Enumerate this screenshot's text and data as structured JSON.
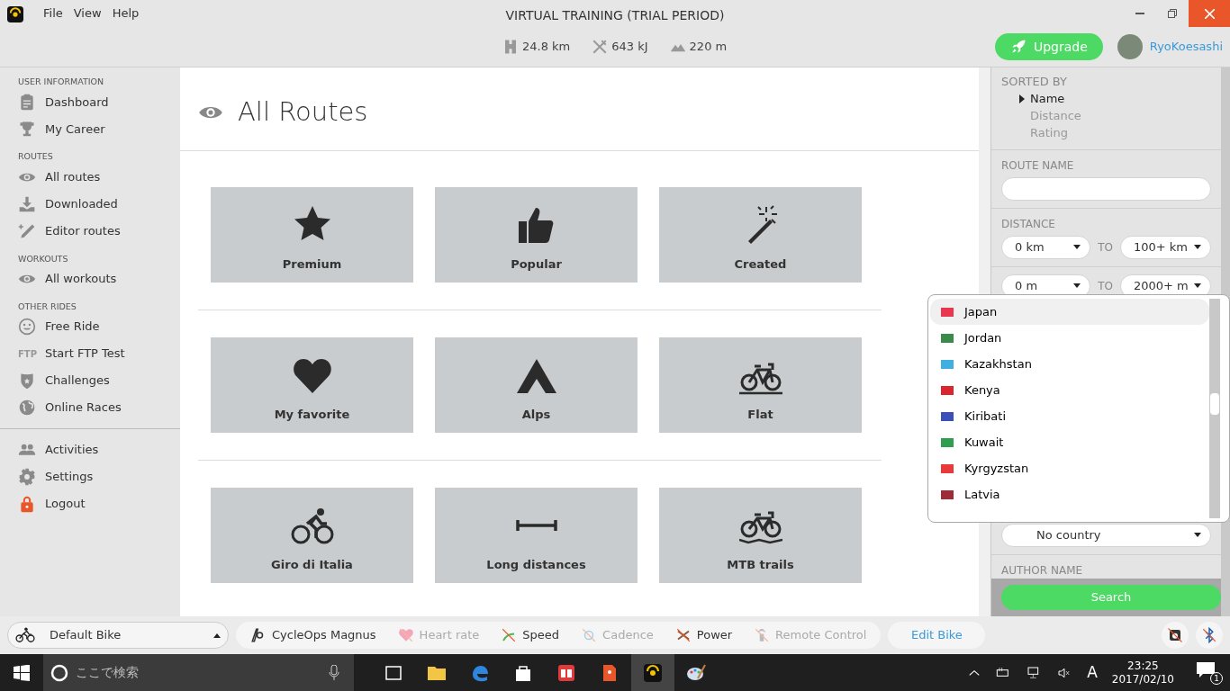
{
  "window": {
    "title": "VIRTUAL TRAINING (TRIAL PERIOD)",
    "menu": [
      "File",
      "View",
      "Help"
    ]
  },
  "stats": [
    {
      "kind": "road",
      "value": "24.8 km"
    },
    {
      "kind": "food",
      "value": "643 kJ"
    },
    {
      "kind": "mountain",
      "value": "220 m"
    }
  ],
  "upgrade_button": "Upgrade",
  "user": {
    "name": "RyoKoesashi"
  },
  "sidebar": [
    {
      "heading": "USER INFORMATION",
      "items": [
        {
          "kind": "clipboard",
          "label": "Dashboard"
        },
        {
          "kind": "trophy",
          "label": "My Career"
        }
      ]
    },
    {
      "heading": "ROUTES",
      "items": [
        {
          "kind": "eye",
          "label": "All routes"
        },
        {
          "kind": "download",
          "label": "Downloaded"
        },
        {
          "kind": "pencil",
          "label": "Editor routes"
        }
      ]
    },
    {
      "heading": "WORKOUTS",
      "items": [
        {
          "kind": "eye",
          "label": "All workouts"
        }
      ]
    },
    {
      "heading": "OTHER RIDES",
      "items": [
        {
          "kind": "smile",
          "label": "Free Ride"
        },
        {
          "kind": "ftp",
          "icon_text": "FTP",
          "label": "Start FTP Test"
        },
        {
          "kind": "shield",
          "label": "Challenges"
        },
        {
          "kind": "globe",
          "label": "Online Races"
        }
      ]
    },
    {
      "items": [
        {
          "kind": "people",
          "label": "Activities"
        },
        {
          "kind": "gear",
          "label": "Settings"
        },
        {
          "kind": "lock",
          "label": "Logout"
        }
      ]
    }
  ],
  "page": {
    "title": "All Routes"
  },
  "tile_rows": [
    [
      {
        "kind": "star",
        "label": "Premium"
      },
      {
        "kind": "thumb",
        "label": "Popular"
      },
      {
        "kind": "wand",
        "label": "Created"
      }
    ],
    [
      {
        "kind": "heart",
        "label": "My favorite"
      },
      {
        "kind": "mountain",
        "label": "Alps"
      },
      {
        "kind": "bike",
        "label": "Flat"
      }
    ],
    [
      {
        "kind": "cyclist",
        "label": "Giro di Italia"
      },
      {
        "kind": "distance",
        "label": "Long distances"
      },
      {
        "kind": "mtb",
        "label": "MTB trails"
      }
    ]
  ],
  "filters": {
    "sorted_by": {
      "heading": "SORTED BY",
      "options": [
        {
          "label": "Name",
          "selected": true
        },
        {
          "label": "Distance",
          "selected": false
        },
        {
          "label": "Rating",
          "selected": false
        }
      ]
    },
    "route_name": {
      "heading": "ROUTE NAME"
    },
    "distance": {
      "heading": "DISTANCE",
      "ranges": [
        {
          "from": "0 km",
          "to_label": "TO",
          "to": "100+ km"
        },
        {
          "from": "0 m",
          "to_label": "TO",
          "to": "2000+ m"
        }
      ]
    },
    "country": {
      "value": "No country"
    },
    "author_name": {
      "heading": "AUTHOR NAME"
    },
    "search_button": "Search"
  },
  "country_dropdown": [
    {
      "label": "Japan",
      "color": "#e8374f",
      "selected": true
    },
    {
      "label": "Jordan",
      "color": "#3a8a4a",
      "selected": false
    },
    {
      "label": "Kazakhstan",
      "color": "#3fb0e0",
      "selected": false
    },
    {
      "label": "Kenya",
      "color": "#d9262e",
      "selected": false
    },
    {
      "label": "Kiribati",
      "color": "#3a4fb8",
      "selected": false
    },
    {
      "label": "Kuwait",
      "color": "#2f9e4f",
      "selected": false
    },
    {
      "label": "Kyrgyzstan",
      "color": "#e83a3a",
      "selected": false
    },
    {
      "label": "Latvia",
      "color": "#9e2b38",
      "selected": false
    }
  ],
  "bottom_bar": {
    "bike": "Default Bike",
    "sensors": [
      {
        "kind": "trainer",
        "label": "CycleOps Magnus",
        "connected": true
      },
      {
        "kind": "heart",
        "label": "Heart rate",
        "connected": false
      },
      {
        "kind": "speed",
        "label": "Speed",
        "connected": true
      },
      {
        "kind": "cadence",
        "label": "Cadence",
        "connected": false
      },
      {
        "kind": "power",
        "label": "Power",
        "connected": true
      },
      {
        "kind": "remote",
        "label": "Remote Control",
        "connected": false
      }
    ],
    "edit_button": "Edit Bike"
  },
  "taskbar": {
    "search_placeholder": "ここで検索",
    "tray_letter": "A",
    "time": "23:25",
    "date": "2017/02/10",
    "notifications": "1"
  }
}
